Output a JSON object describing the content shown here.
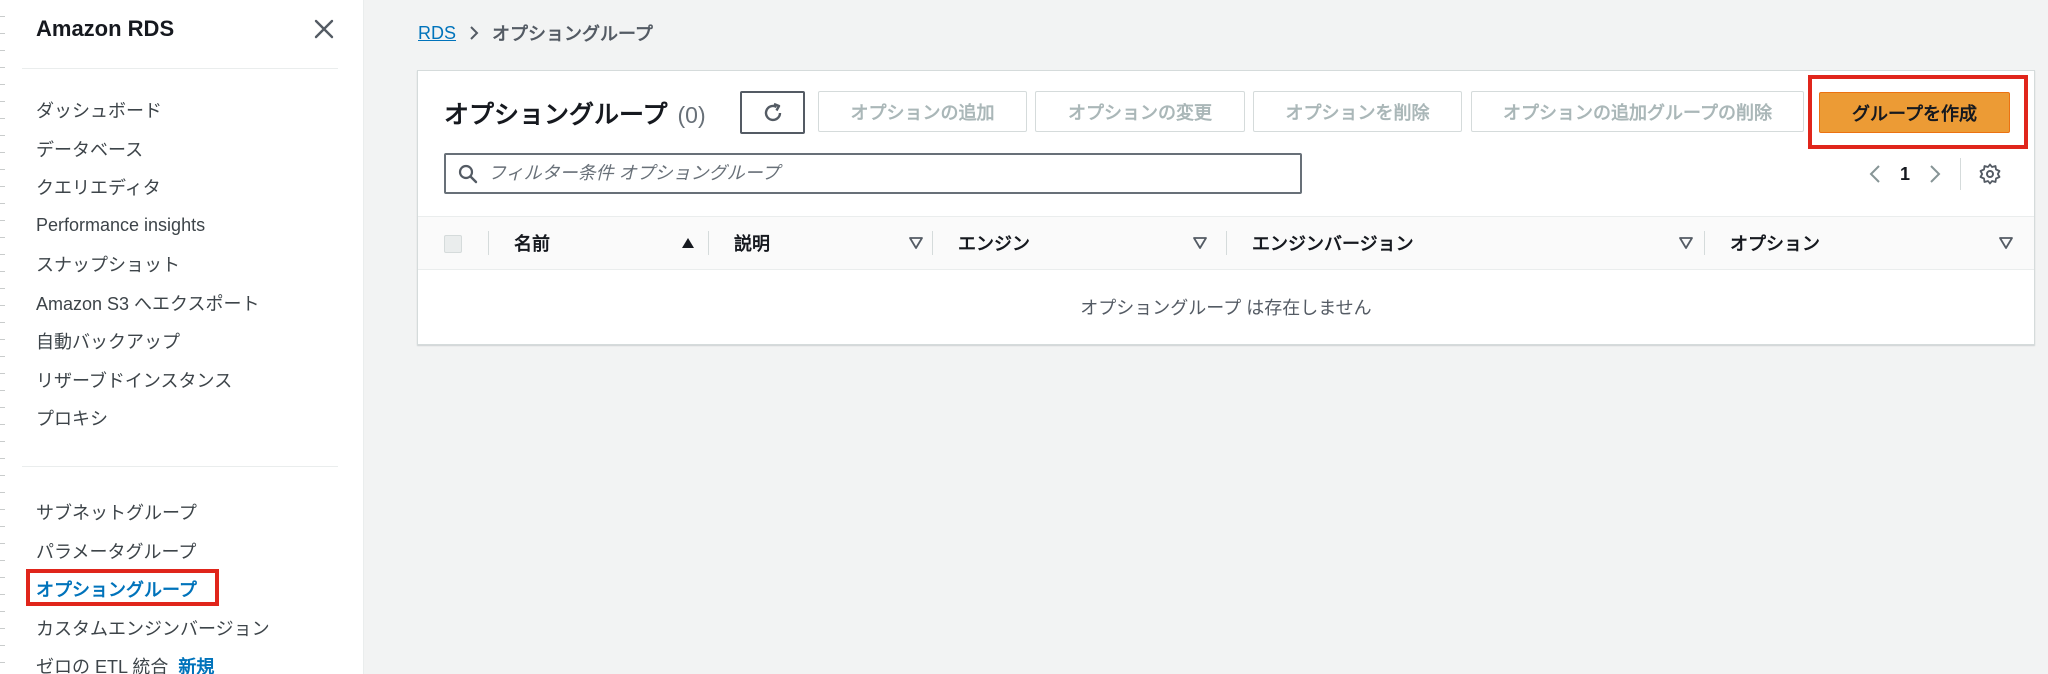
{
  "sidebar": {
    "title": "Amazon RDS",
    "items": [
      {
        "label": "ダッシュボード"
      },
      {
        "label": "データベース"
      },
      {
        "label": "クエリエディタ"
      },
      {
        "label": "Performance insights"
      },
      {
        "label": "スナップショット"
      },
      {
        "label": "Amazon S3 へエクスポート"
      },
      {
        "label": "自動バックアップ"
      },
      {
        "label": "リザーブドインスタンス"
      },
      {
        "label": "プロキシ"
      }
    ],
    "items2": [
      {
        "label": "サブネットグループ"
      },
      {
        "label": "パラメータグループ"
      },
      {
        "label": "オプショングループ",
        "active": true
      },
      {
        "label": "カスタムエンジンバージョン"
      },
      {
        "label": "ゼロの ETL 統合",
        "badge": "新規"
      }
    ]
  },
  "breadcrumb": {
    "root": "RDS",
    "current": "オプショングループ"
  },
  "panel": {
    "title": "オプショングループ",
    "count": "(0)",
    "buttons": {
      "add_option": "オプションの追加",
      "modify_option": "オプションの変更",
      "delete_option": "オプションを削除",
      "delete_group": "オプションの追加グループの削除",
      "create_group": "グループを作成"
    },
    "search_placeholder": "フィルター条件 オプショングループ",
    "page": "1",
    "columns": [
      "名前",
      "説明",
      "エンジン",
      "エンジンバージョン",
      "オプション"
    ],
    "empty_message": "オプショングループ は存在しません"
  },
  "colors": {
    "accent": "#0073bb",
    "primary_button": "#ec9b35",
    "highlight": "#e0251b"
  }
}
